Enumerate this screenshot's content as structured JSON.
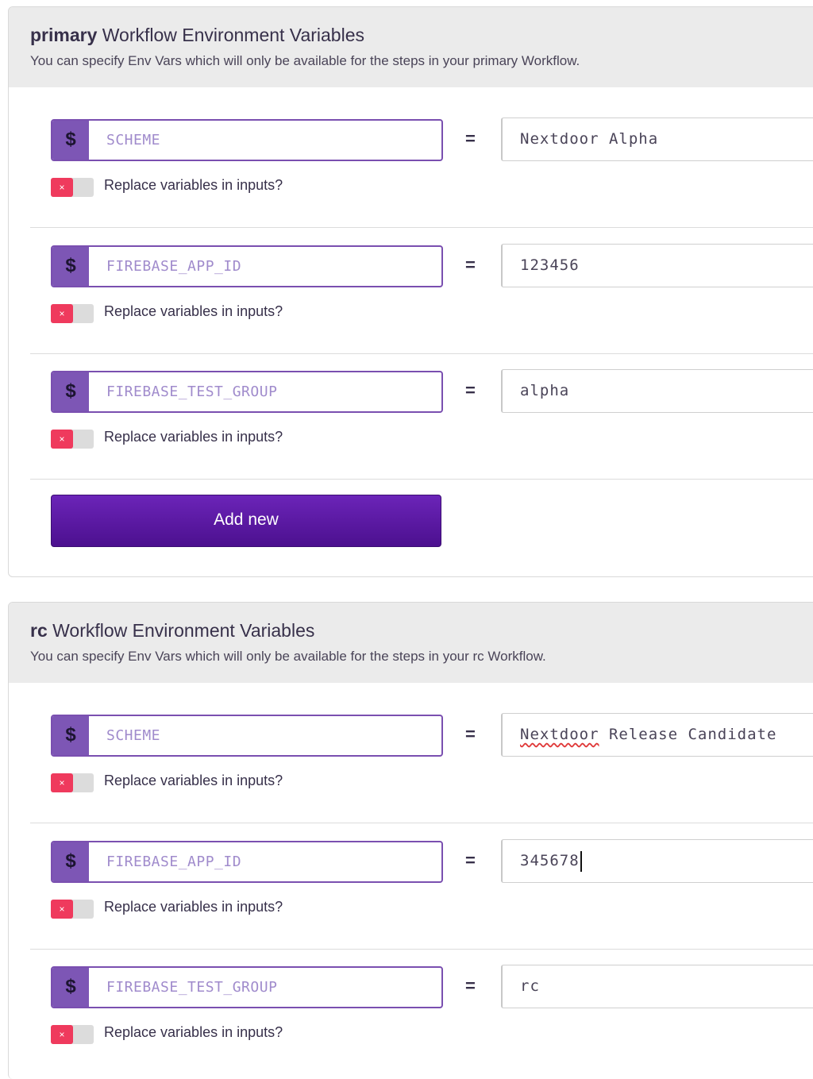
{
  "sections": [
    {
      "workflow": "primary",
      "title_suffix": "Workflow Environment Variables",
      "description": "You can specify Env Vars which will only be available for the steps in your primary Workflow.",
      "variables": [
        {
          "key": "SCHEME",
          "value": "Nextdoor Alpha",
          "replace_label": "Replace variables in inputs?",
          "replace_enabled": false
        },
        {
          "key": "FIREBASE_APP_ID",
          "value": "123456",
          "replace_label": "Replace variables in inputs?",
          "replace_enabled": false
        },
        {
          "key": "FIREBASE_TEST_GROUP",
          "value": "alpha",
          "replace_label": "Replace variables in inputs?",
          "replace_enabled": false
        }
      ],
      "add_button_label": "Add new"
    },
    {
      "workflow": "rc",
      "title_suffix": "Workflow Environment Variables",
      "description": "You can specify Env Vars which will only be available for the steps in your rc Workflow.",
      "variables": [
        {
          "key": "SCHEME",
          "value_misspelled_word": "Nextdoor",
          "value_rest": " Release Candidate",
          "replace_label": "Replace variables in inputs?",
          "replace_enabled": false
        },
        {
          "key": "FIREBASE_APP_ID",
          "value": "345678",
          "replace_label": "Replace variables in inputs?",
          "replace_enabled": false
        },
        {
          "key": "FIREBASE_TEST_GROUP",
          "value": "rc",
          "replace_label": "Replace variables in inputs?",
          "replace_enabled": false
        }
      ]
    }
  ],
  "symbols": {
    "dollar": "$",
    "equals": "=",
    "toggle_off": "×"
  },
  "colors": {
    "accent": "#7d56b5",
    "button": "#5a179f",
    "toggle_off": "#ef3a5d"
  }
}
